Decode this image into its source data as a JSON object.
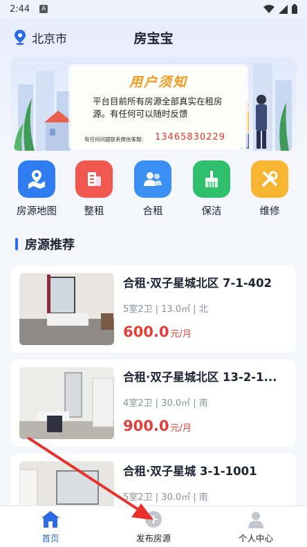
{
  "status": {
    "time": "2:44",
    "badge": "A"
  },
  "header": {
    "city": "北京市",
    "title": "房宝宝"
  },
  "banner": {
    "title": "用户须知",
    "text": "平台目前所有房源全部真实在租房源。有任何可以随时反馈",
    "contact_label": "有任何问题联系微信客服:",
    "phone": "13465830229"
  },
  "categories": [
    {
      "label": "房源地图",
      "icon": "map-icon",
      "color": "#2f7bf0"
    },
    {
      "label": "整租",
      "icon": "building-icon",
      "color": "#f0584f"
    },
    {
      "label": "合租",
      "icon": "people-icon",
      "color": "#3b8ff3"
    },
    {
      "label": "保洁",
      "icon": "broom-icon",
      "color": "#2fbf6d"
    },
    {
      "label": "维修",
      "icon": "tools-icon",
      "color": "#f7b531"
    }
  ],
  "section": {
    "title": "房源推荐"
  },
  "listings": [
    {
      "name": "合租·双子星城北区 7-1-402",
      "spec": "5室2卫 | 13.0㎡ | 北",
      "price": "600.0",
      "unit": "元/月"
    },
    {
      "name": "合租·双子星城北区 13-2-1...",
      "spec": "4室2卫 | 30.0㎡ | 南",
      "price": "900.0",
      "unit": "元/月"
    },
    {
      "name": "合租·双子星城 3-1-1001",
      "spec": "5室2卫 | 30.0㎡ | 南",
      "price": "",
      "unit": ""
    }
  ],
  "tabbar": {
    "home": "首页",
    "publish": "发布房源",
    "profile": "个人中心"
  },
  "colors": {
    "accent": "#2b6be6",
    "price": "#e23f3a",
    "annotation_arrow": "#e8312b"
  }
}
